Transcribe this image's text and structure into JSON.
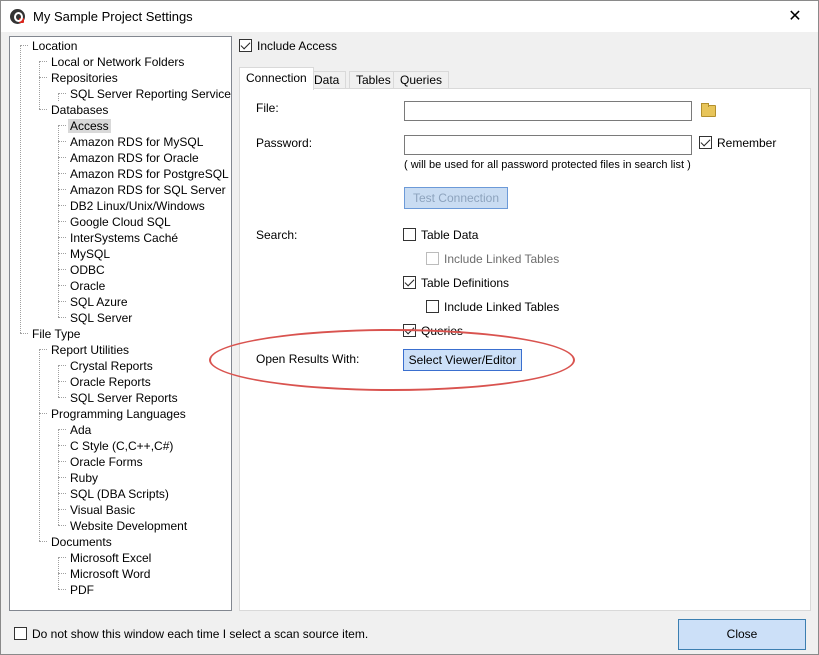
{
  "window": {
    "title": "My Sample Project Settings",
    "close_glyph": "✕"
  },
  "tree": {
    "items": [
      {
        "label": "Location"
      },
      {
        "label": "Local or Network Folders"
      },
      {
        "label": "Repositories"
      },
      {
        "label": "SQL Server Reporting Services"
      },
      {
        "label": "Databases"
      },
      {
        "label": "Access"
      },
      {
        "label": "Amazon RDS for MySQL"
      },
      {
        "label": "Amazon RDS for Oracle"
      },
      {
        "label": "Amazon RDS for PostgreSQL"
      },
      {
        "label": "Amazon RDS for SQL Server"
      },
      {
        "label": "DB2 Linux/Unix/Windows"
      },
      {
        "label": "Google Cloud SQL"
      },
      {
        "label": "InterSystems Caché"
      },
      {
        "label": "MySQL"
      },
      {
        "label": "ODBC"
      },
      {
        "label": "Oracle"
      },
      {
        "label": "SQL Azure"
      },
      {
        "label": "SQL Server"
      },
      {
        "label": "File Type"
      },
      {
        "label": "Report Utilities"
      },
      {
        "label": "Crystal Reports"
      },
      {
        "label": "Oracle Reports"
      },
      {
        "label": "SQL Server Reports"
      },
      {
        "label": "Programming Languages"
      },
      {
        "label": "Ada"
      },
      {
        "label": "C Style (C,C++,C#)"
      },
      {
        "label": "Oracle Forms"
      },
      {
        "label": "Ruby"
      },
      {
        "label": "SQL (DBA Scripts)"
      },
      {
        "label": "Visual Basic"
      },
      {
        "label": "Website Development"
      },
      {
        "label": "Documents"
      },
      {
        "label": "Microsoft Excel"
      },
      {
        "label": "Microsoft Word"
      },
      {
        "label": "PDF"
      }
    ]
  },
  "include_access": {
    "label": "Include Access",
    "checked": true
  },
  "tabs": [
    {
      "label": "Connection"
    },
    {
      "label": "Data"
    },
    {
      "label": "Tables"
    },
    {
      "label": "Queries"
    }
  ],
  "connection": {
    "file_label": "File:",
    "file_value": "",
    "password_label": "Password:",
    "password_value": "",
    "remember_label": "Remember",
    "password_note": "( will be used for all password protected files in search list )",
    "test_button": "Test Connection",
    "search_label": "Search:",
    "table_data": "Table Data",
    "include_linked_1": "Include Linked Tables",
    "table_definitions": "Table Definitions",
    "include_linked_2": "Include Linked Tables",
    "queries": "Queries",
    "open_results_label": "Open Results With:",
    "select_viewer_button": "Select Viewer/Editor"
  },
  "footer": {
    "dont_show_label": "Do not show this window each time I select a scan source item.",
    "close_button": "Close"
  }
}
